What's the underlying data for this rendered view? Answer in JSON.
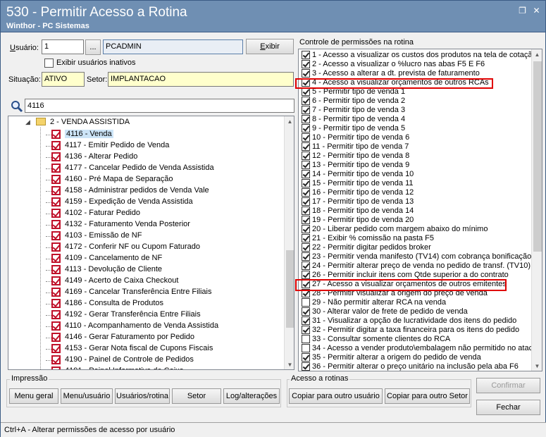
{
  "window": {
    "title": "530 - Permitir Acesso a Rotina",
    "subtitle": "Winthor - PC Sistemas",
    "restore_icon": "restore-icon",
    "close_icon": "close-icon"
  },
  "user": {
    "label": "Usuário:",
    "code": "1",
    "browse_label": "...",
    "name": "PCADMIN",
    "show_button": "Exibir",
    "inactive_label": "Exibir usuários inativos",
    "situacao_label": "Situação:",
    "situacao_value": "ATIVO",
    "setor_label": "Setor:",
    "setor_value": "IMPLANTACAO"
  },
  "search": {
    "icon": "search-icon",
    "value": "4116"
  },
  "tree": {
    "group_label": "2 - VENDA ASSISTIDA",
    "items": [
      {
        "label": "4116 - Venda"
      },
      {
        "label": "4117 - Emitir Pedido de Venda"
      },
      {
        "label": "4136 - Alterar Pedido"
      },
      {
        "label": "4177 - Cancelar Pedido de Venda Assistida"
      },
      {
        "label": "4160 - Pré Mapa de Separação"
      },
      {
        "label": "4158 - Administrar pedidos de Venda Vale"
      },
      {
        "label": "4159 - Expedição de Venda Assistida"
      },
      {
        "label": "4102 - Faturar Pedido"
      },
      {
        "label": "4132 - Faturamento Venda Posterior"
      },
      {
        "label": "4103 - Emissão de NF"
      },
      {
        "label": "4172 - Conferir NF ou Cupom Faturado"
      },
      {
        "label": "4109 - Cancelamento de NF"
      },
      {
        "label": "4113 - Devolução de Cliente"
      },
      {
        "label": "4149 - Acerto de Caixa Checkout"
      },
      {
        "label": "4169 - Cancelar Transferência Entre Filiais"
      },
      {
        "label": "4186 - Consulta de Produtos"
      },
      {
        "label": "4192 - Gerar Transferência Entre Filiais"
      },
      {
        "label": "4110 - Acompanhamento de Venda Assistida"
      },
      {
        "label": "4146 - Gerar Faturamento por Pedido"
      },
      {
        "label": "4153 - Gerar Nota fiscal de Cupons Fiscais"
      },
      {
        "label": "4190 - Painel de Controle de Pedidos"
      },
      {
        "label": "4191 - Painel Informativo de Caixa"
      }
    ]
  },
  "permissions": {
    "title": "Controle de permissões na rotina",
    "items": [
      {
        "label": "1 - Acesso a visualizar os custos dos produtos na tela de cotaçã",
        "checked": true
      },
      {
        "label": "2 - Acesso a visualizar o %lucro nas abas F5 E F6",
        "checked": true
      },
      {
        "label": "3 - Acesso a alterar a dt. prevista de faturamento",
        "checked": true
      },
      {
        "label": "4 - Acesso a visualizar orçamentos de outros RCAs",
        "checked": true
      },
      {
        "label": "5 - Permitir tipo de venda 1",
        "checked": true
      },
      {
        "label": "6 - Permitir tipo de venda 2",
        "checked": true
      },
      {
        "label": "7 - Permitir tipo de venda 3",
        "checked": true
      },
      {
        "label": "8 - Permitir tipo de venda 4",
        "checked": true
      },
      {
        "label": "9 - Permitir tipo de venda 5",
        "checked": true
      },
      {
        "label": "10 - Permitir tipo de venda 6",
        "checked": true
      },
      {
        "label": "11 - Permitir tipo de venda 7",
        "checked": true
      },
      {
        "label": "12 - Permitir tipo de venda 8",
        "checked": true
      },
      {
        "label": "13 - Permitir tipo de venda 9",
        "checked": true
      },
      {
        "label": "14 - Permitir tipo de venda 10",
        "checked": true
      },
      {
        "label": "15 - Permitir tipo de venda 11",
        "checked": true
      },
      {
        "label": "16 - Permitir tipo de venda 12",
        "checked": true
      },
      {
        "label": "17 - Permitir tipo de venda 13",
        "checked": true
      },
      {
        "label": "18 - Permitir tipo de venda 14",
        "checked": true
      },
      {
        "label": "19 - Permitir tipo de venda 20",
        "checked": true
      },
      {
        "label": "20 - Liberar pedido com margem abaixo do mínimo",
        "checked": true
      },
      {
        "label": "21 - Exibir % comissão na pasta F5",
        "checked": true
      },
      {
        "label": "22 - Permitir digitar pedidos broker",
        "checked": true
      },
      {
        "label": "23 - Permitir venda manifesto (TV14) com cobrança bonificação",
        "checked": true
      },
      {
        "label": "24 - Permitir alterar preço de venda no pedido de transf. (TV10)",
        "checked": true
      },
      {
        "label": "26 - Permitir incluir itens com Qtde superior a do contrato",
        "checked": true
      },
      {
        "label": "27 - Acesso a visualizar orçamentos de outros emitentes",
        "checked": true
      },
      {
        "label": "28 - Permitir visualizar a origem do preço de venda",
        "checked": true
      },
      {
        "label": "29 - Não permitir alterar RCA na venda",
        "checked": false
      },
      {
        "label": "30 - Alterar valor de frete de pedido de venda",
        "checked": true
      },
      {
        "label": "31 - Visualizar a opção de lucratividade dos itens do pedido",
        "checked": true
      },
      {
        "label": "32 - Permitir digitar a taxa financeira para os itens do pedido",
        "checked": true
      },
      {
        "label": "33 - Consultar somente clientes do RCA",
        "checked": false
      },
      {
        "label": "34 - Acesso a vender produto\\embalagem não permitido no atac",
        "checked": false
      },
      {
        "label": "35 - Permitir alterar a origem do pedido de venda",
        "checked": true
      },
      {
        "label": "36 - Permitir alterar o preço unitário na inclusão pela aba F6",
        "checked": true
      }
    ]
  },
  "impressao": {
    "title": "Impressão",
    "buttons": [
      "Menu geral",
      "Menu/usuário",
      "Usuários/rotina",
      "Setor",
      "Log/alterações"
    ]
  },
  "acesso": {
    "title": "Acesso a rotinas",
    "copy_other_user": "Copiar para outro usuário",
    "copy_other_setor": "Copiar para outro Setor"
  },
  "actions": {
    "confirm": "Confirmar",
    "close": "Fechar"
  },
  "status": {
    "text": "Ctrl+A - Alterar permissões de acesso por usuário"
  }
}
